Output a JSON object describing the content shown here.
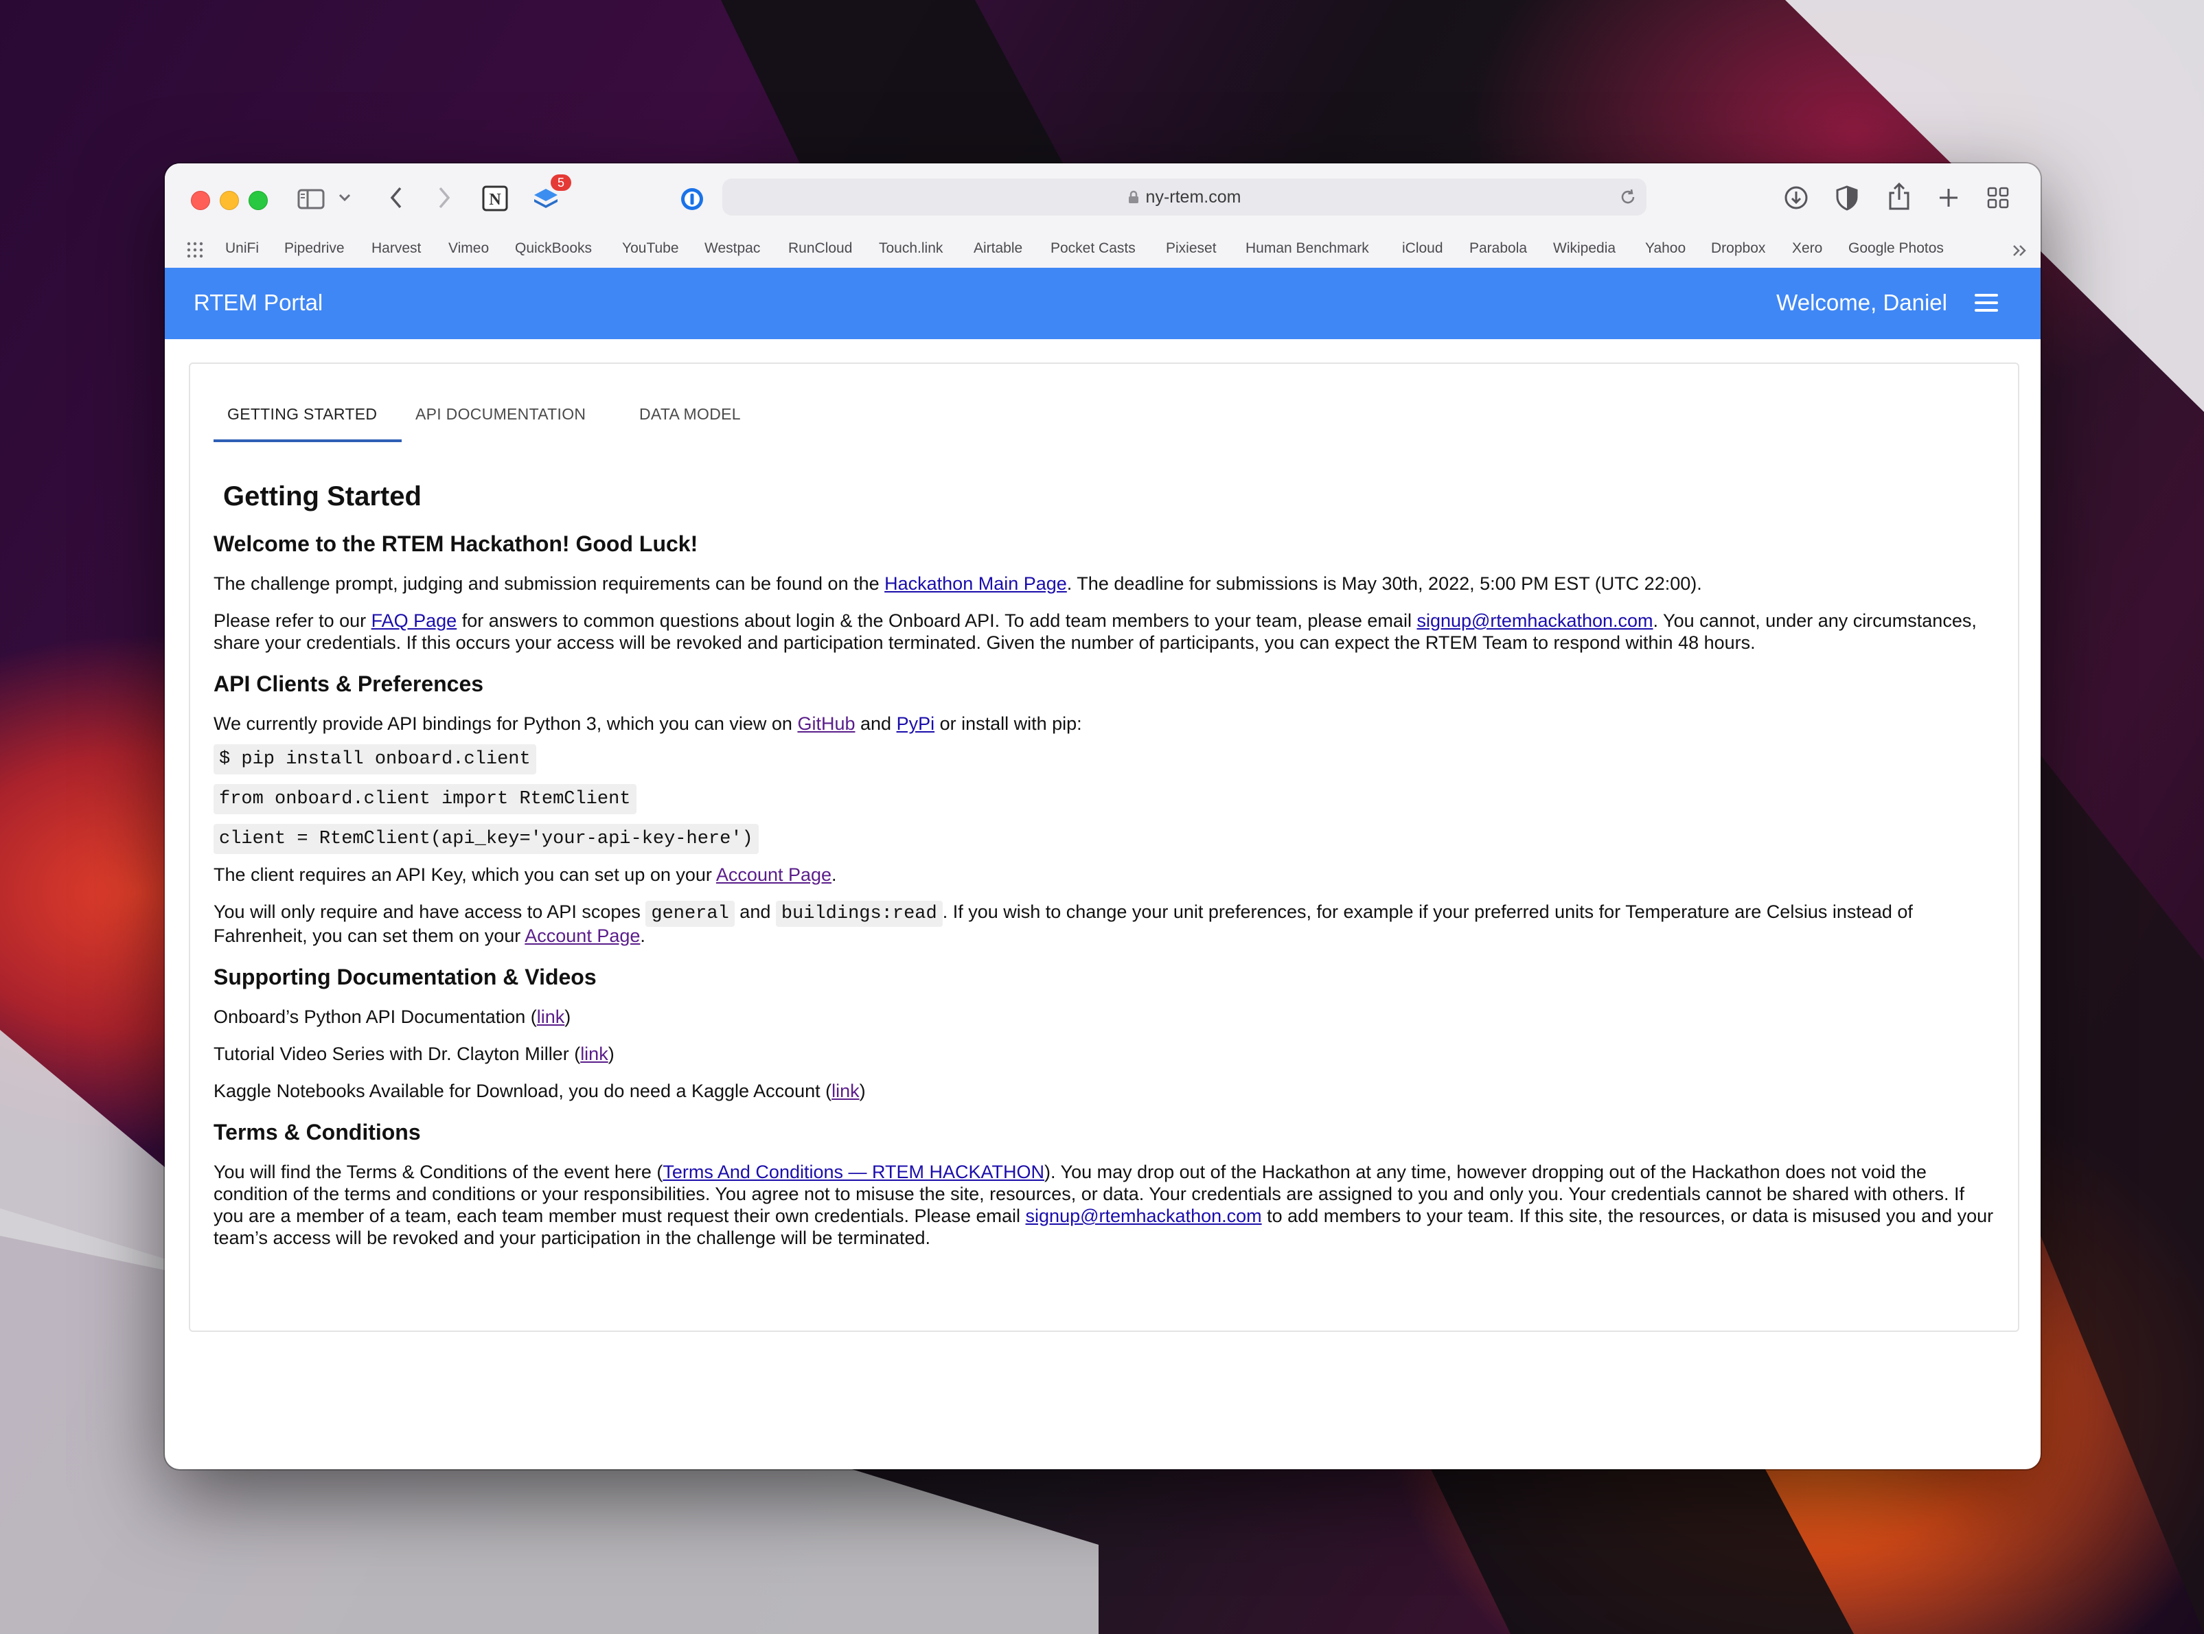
{
  "browser": {
    "url": "ny-rtem.com",
    "badge_count": "5",
    "bookmarks": [
      "UniFi",
      "Pipedrive",
      "Harvest",
      "Vimeo",
      "QuickBooks",
      "YouTube",
      "Westpac",
      "RunCloud",
      "Touch.link",
      "Airtable",
      "Pocket Casts",
      "Pixieset",
      "Human Benchmark",
      "iCloud",
      "Parabola",
      "Wikipedia",
      "Yahoo",
      "Dropbox",
      "Xero",
      "Google Photos"
    ]
  },
  "appbar": {
    "title": "RTEM Portal",
    "welcome": "Welcome, Daniel"
  },
  "tabs": [
    "GETTING STARTED",
    "API DOCUMENTATION",
    "DATA MODEL"
  ],
  "content": {
    "h1": "Getting Started",
    "welcome_heading": "Welcome to the RTEM Hackathon! Good Luck!",
    "p1_a": "The challenge prompt, judging and submission requirements can be found on the ",
    "p1_link": "Hackathon Main Page",
    "p1_b": ". The deadline for submissions is May 30th, 2022, 5:00 PM EST (UTC 22:00).",
    "p2_a": "Please refer to our ",
    "p2_link1": "FAQ Page",
    "p2_b": " for answers to common questions about login & the Onboard API. To add team members to your team, please email ",
    "p2_link2": "signup@rtemhackathon.com",
    "p2_c": ". You cannot, under any circumstances, share your credentials. If this occurs your access will be revoked and participation terminated. Given the number of participants, you can expect the RTEM Team to respond within 48 hours.",
    "h_api": "API Clients & Preferences",
    "p3_a": "We currently provide API bindings for Python 3, which you can view on ",
    "p3_link1": "GitHub",
    "p3_b": " and ",
    "p3_link2": "PyPi",
    "p3_c": " or install with pip:",
    "code1": "$ pip install onboard.client",
    "code2": "from onboard.client import RtemClient",
    "code3": "client = RtemClient(api_key='your-api-key-here')",
    "p4_a": "The client requires an API Key, which you can set up on your ",
    "p4_link": "Account Page",
    "p4_b": ".",
    "p5_a": "You will only require and have access to API scopes ",
    "p5_code1": "general",
    "p5_b": " and ",
    "p5_code2": "buildings:read",
    "p5_c": ". If you wish to change your unit preferences, for example if your preferred units for Temperature are Celsius instead of Fahrenheit, you can set them on your ",
    "p5_link": "Account Page",
    "p5_d": ".",
    "h_docs": "Supporting Documentation & Videos",
    "doc1_a": "Onboard’s Python API Documentation (",
    "doc2_a": "Tutorial Video Series with Dr. Clayton Miller (",
    "doc3_a": "Kaggle Notebooks Available for Download, you do need a Kaggle Account (",
    "link_word": "link",
    "close_paren": ")",
    "h_terms": "Terms & Conditions",
    "p6_a": "You will find the Terms & Conditions of the event here (",
    "p6_link1": "Terms And Conditions — RTEM HACKATHON",
    "p6_b": "). You may drop out of the Hackathon at any time, however dropping out of the Hackathon does not void the condition of the terms and conditions or your responsibilities. You agree not to misuse the site, resources, or data. Your credentials are assigned to you and only you. Your credentials cannot be shared with others. If you are a member of a team, each team member must request their own credentials. Please email ",
    "p6_link2": "signup@rtemhackathon.com",
    "p6_c": " to add members to your team. If this site, the resources, or data is misused you and your team’s access will be revoked and your participation in the challenge will be terminated."
  }
}
